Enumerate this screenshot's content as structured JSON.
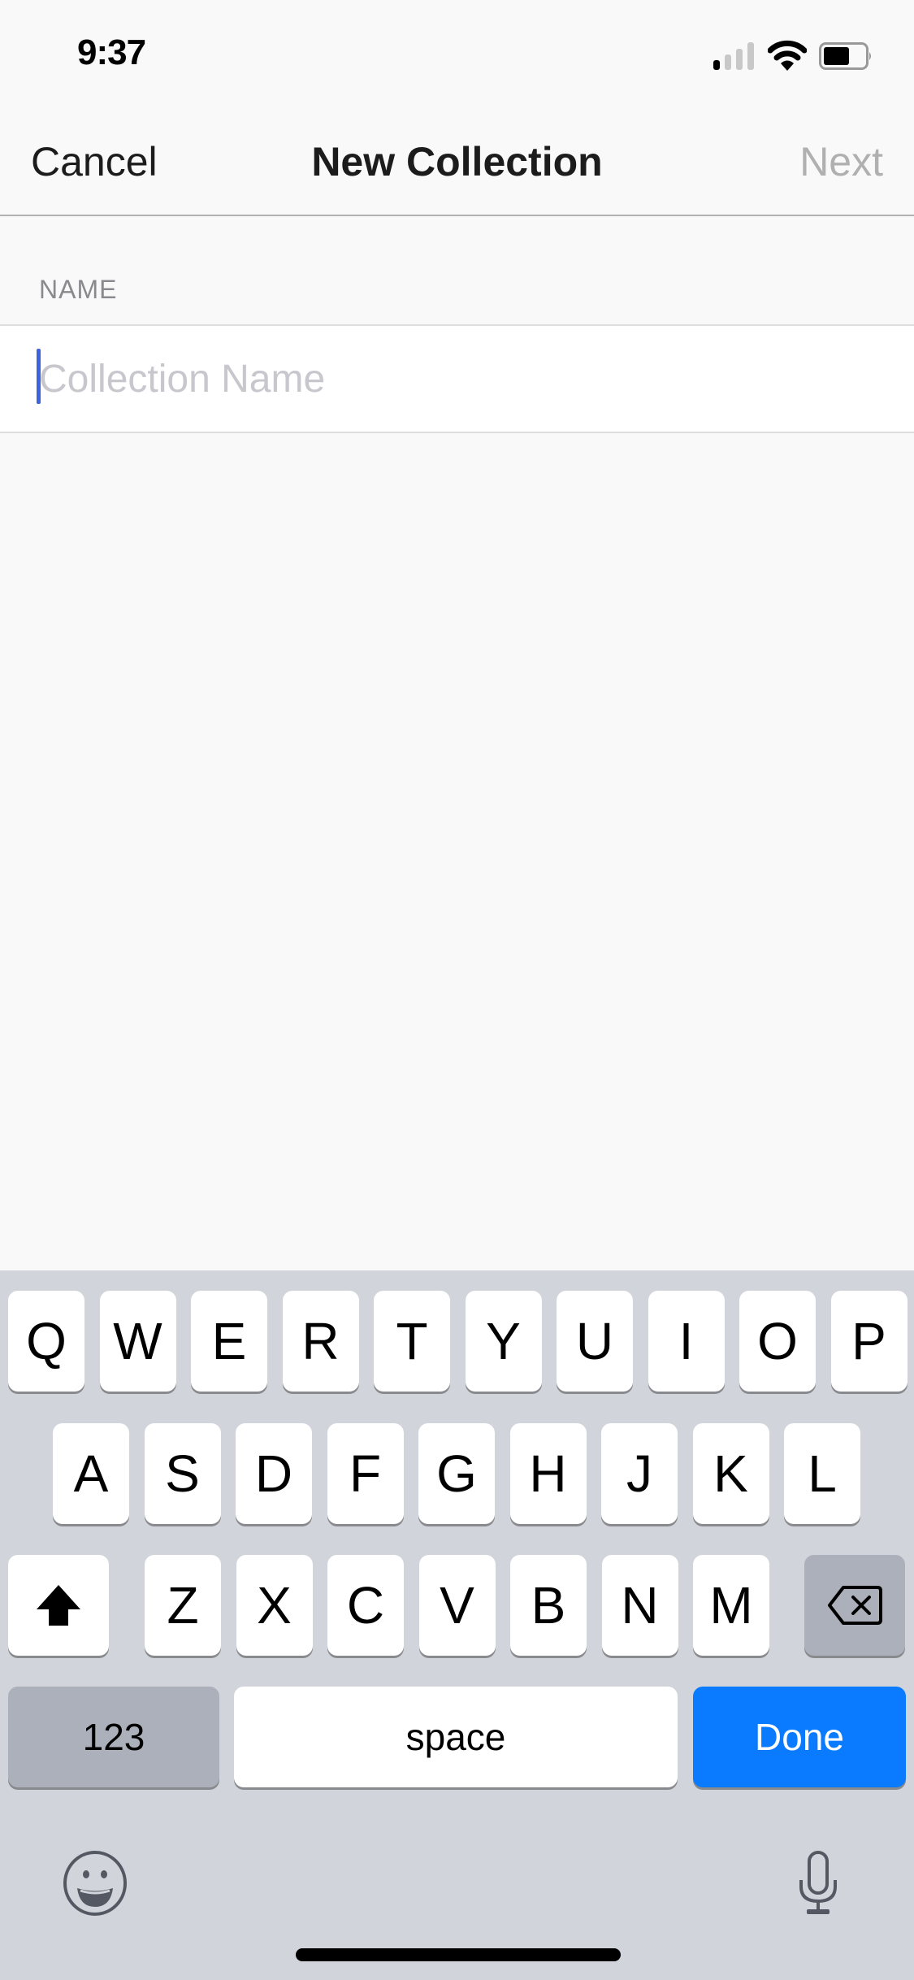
{
  "status_bar": {
    "time": "9:37",
    "signal_icon": "cellular-signal-icon",
    "signal_bars_active": 1,
    "signal_bars_total": 4,
    "wifi_icon": "wifi-icon",
    "battery_icon": "battery-icon",
    "battery_level_percent": 60
  },
  "nav": {
    "cancel_label": "Cancel",
    "title": "New Collection",
    "next_label": "Next"
  },
  "form": {
    "section_label": "NAME",
    "name_field": {
      "value": "",
      "placeholder": "Collection Name"
    }
  },
  "keyboard": {
    "row1": [
      "Q",
      "W",
      "E",
      "R",
      "T",
      "Y",
      "U",
      "I",
      "O",
      "P"
    ],
    "row2": [
      "A",
      "S",
      "D",
      "F",
      "G",
      "H",
      "J",
      "K",
      "L"
    ],
    "row3": [
      "Z",
      "X",
      "C",
      "V",
      "B",
      "N",
      "M"
    ],
    "shift_icon": "shift-arrow-icon",
    "delete_icon": "backspace-icon",
    "numbers_label": "123",
    "space_label": "space",
    "done_label": "Done",
    "emoji_icon": "emoji-icon",
    "mic_icon": "microphone-icon"
  },
  "colors": {
    "accent": "#0a7aff",
    "caret": "#3e63e0",
    "background": "#f9f9f9",
    "keyboard_bg": "#d1d5db"
  }
}
